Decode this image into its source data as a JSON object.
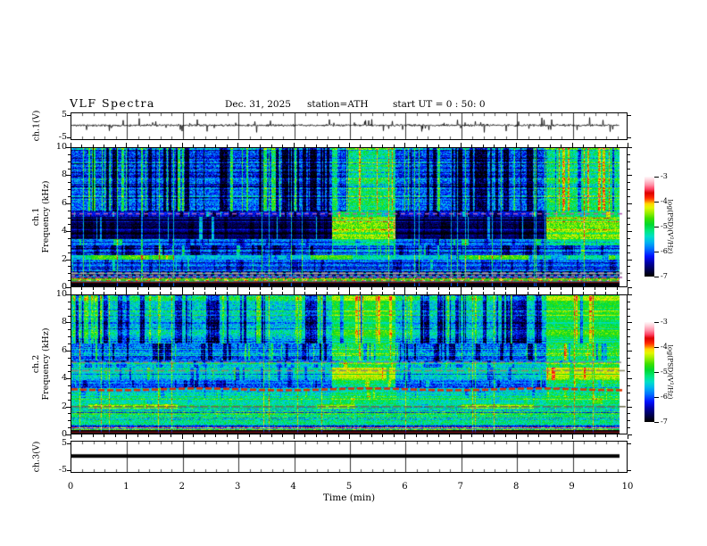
{
  "title": {
    "main": "VLF  Spectra",
    "date": "Dec. 31,  2025",
    "station": "station=ATH",
    "start_ut": "start  UT  =   0 : 50: 0"
  },
  "axes": {
    "x": {
      "label": "Time  (min)",
      "range_min": [
        0,
        10
      ],
      "ticks": [
        0,
        1,
        2,
        3,
        4,
        5,
        6,
        7,
        8,
        9,
        10
      ],
      "minor_step_min": 0.2
    },
    "spectrogram_y": {
      "unit": "kHz",
      "range": [
        0,
        10
      ],
      "ticks": [
        10,
        8,
        6,
        4,
        2,
        0
      ],
      "minor_step": 0.5
    },
    "waveform_y": {
      "unit": "V",
      "range": [
        -5,
        5
      ],
      "ticks": [
        5,
        -5
      ]
    }
  },
  "panels": [
    {
      "id": "ch1_wave",
      "ylabel": "ch.1(V)"
    },
    {
      "id": "ch1_spec",
      "ylabel_line1": "ch.1",
      "ylabel_line2": "Frequency  (kHz)"
    },
    {
      "id": "ch2_spec",
      "ylabel_line1": "ch.2",
      "ylabel_line2": "Frequency  (kHz)"
    },
    {
      "id": "ch3_wave",
      "ylabel": "ch.3(V)"
    }
  ],
  "colorbar": {
    "label": "log(PSD)(V²/Hz)",
    "ticks": [
      -3,
      -4,
      -5,
      -6,
      -7
    ],
    "range_log_psd": [
      -7,
      -3
    ]
  },
  "chart_data": [
    {
      "panel": "ch.1 waveform",
      "type": "line",
      "x_unit": "min",
      "y_unit": "V",
      "x_range": [
        0,
        9.84
      ],
      "y_range": [
        -5,
        5
      ],
      "baseline_v": 0.45,
      "noise_sd_v": 0.5,
      "spike_rate": 0.045,
      "spike_v_range": [
        1.2,
        3.6
      ],
      "seed": 11,
      "description": "continuous broadband noise trace near 0 V with frequent narrow spikes to about ±4 V"
    },
    {
      "panel": "ch.1 spectrogram",
      "type": "heatmap",
      "seed": 7,
      "t_end_min": 9.84,
      "f_range_khz": [
        0,
        10
      ],
      "psd_log_range": [
        -7,
        -3
      ],
      "bright_segments_min": [
        [
          4.68,
          5.82
        ],
        [
          8.52,
          9.84
        ]
      ],
      "sferic_prob": 0.035,
      "sferic_boost": 1.05,
      "row_var": 0.22,
      "regions": [
        {
          "f": [
            5.45,
            10
          ],
          "base": -6.05,
          "noise": 0.45,
          "dark_p": 0.32,
          "dark_d": -0.85,
          "bright_p": 0.13,
          "bright_d": 1.05,
          "seg_base": -5.15,
          "seg_dark_p": 0.1,
          "seg_bright_p": 0.16
        },
        {
          "f": [
            5.05,
            5.45
          ],
          "base": -6.25,
          "noise": 0.32,
          "dark_p": 0.2,
          "dark_d": -0.5,
          "bright_p": 0.05,
          "bright_d": 0.8,
          "seg_base": -5.0
        },
        {
          "f": [
            3.45,
            5.05
          ],
          "base": -6.75,
          "noise": 0.22,
          "dark_p": 0.28,
          "dark_d": -0.22,
          "bright_p": 0.04,
          "bright_d": 1.15,
          "seg_base": -4.6,
          "seg_noise": 0.4,
          "seg_dark_p": 0.03,
          "seg_bright_p": 0.05
        },
        {
          "f": [
            3.0,
            3.45
          ],
          "base": -5.9,
          "noise": 0.35,
          "dark_p": 0.15,
          "dark_d": -0.5,
          "bright_p": 0.06,
          "bright_d": 0.8,
          "seg_base": -5.2
        },
        {
          "f": [
            2.25,
            3.0
          ],
          "base": -6.15,
          "noise": 0.4,
          "dark_p": 0.25,
          "dark_d": -0.55,
          "bright_p": 0.07,
          "bright_d": 0.9,
          "seg_base": -5.9
        },
        {
          "f": [
            1.95,
            2.25
          ],
          "base": -5.55,
          "noise": 0.35,
          "dark_p": 0.1,
          "dark_d": -0.4,
          "bright_p": 0.05,
          "bright_d": 0.5,
          "seg_base": -5.3,
          "band_segments": [
            [
              0.25,
              1.85
            ],
            [
              4.3,
              5.05
            ],
            [
              6.95,
              8.2
            ]
          ],
          "band_base": -4.7,
          "band_noise": 0.3
        },
        {
          "f": [
            1.1,
            1.95
          ],
          "base": -5.95,
          "noise": 0.4,
          "dark_p": 0.2,
          "dark_d": -0.4,
          "bright_p": 0.05,
          "bright_d": 0.7
        },
        {
          "f": [
            0.55,
            1.1
          ],
          "base": -6.0,
          "noise": 0.5,
          "stripe_amp": 1.0
        },
        {
          "f": [
            0.28,
            0.55
          ],
          "base": -5.4,
          "noise": 0.6,
          "stripe_amp": 1.3
        },
        {
          "f": [
            0,
            0.28
          ],
          "base": -6.9,
          "noise": 0.12
        }
      ],
      "feature_lines": [
        {
          "f_khz": 5.25,
          "color": "#b05ab0",
          "dash": [
            5,
            4
          ],
          "w": 1.5
        },
        {
          "f_khz": 0.95,
          "color": "#a8a8a8",
          "dash": [
            7,
            3
          ],
          "w": 2
        },
        {
          "f_khz": 0.8,
          "color": "#8f8f8f",
          "dash": [
            4,
            4
          ],
          "w": 1.5
        },
        {
          "f_khz": 0.65,
          "color": "#a050a0",
          "dash": [
            5,
            4
          ],
          "w": 1.5
        },
        {
          "f_khz": 0.45,
          "color": "#22b822",
          "dash": [
            6,
            5
          ],
          "w": 1.5
        },
        {
          "f_khz": 0.3,
          "color": "#7a1212",
          "dash": [
            1,
            0
          ],
          "w": 1.5
        }
      ],
      "description": "blue background with dense dark-blue vertical sferic stripes above 5.5 kHz, near-black band 3.5-5 kHz, purple dashed line at 5.25 kHz, yellow-green band near 2.1 kHz in intervals, gray/purple/green line stack below 1 kHz, black at 0; green emission band 3.5-5 kHz during 4.7-5.8 and 8.5-9.8 min"
    },
    {
      "panel": "ch.2 spectrogram",
      "type": "heatmap",
      "seed": 13,
      "t_end_min": 9.84,
      "f_range_khz": [
        0,
        10
      ],
      "psd_log_range": [
        -7,
        -3
      ],
      "bright_segments_min": [
        [
          4.68,
          5.82
        ],
        [
          8.52,
          9.84
        ]
      ],
      "sferic_prob": 0.03,
      "sferic_boost": 0.9,
      "row_var": 0.22,
      "regions": [
        {
          "f": [
            6.5,
            10
          ],
          "base": -5.45,
          "noise": 0.45,
          "dark_p": 0.3,
          "dark_d": -1.0,
          "bright_p": 0.1,
          "bright_d": 0.65,
          "seg_base": -4.85,
          "seg_dark_p": 0.05,
          "seg_noise": 0.3
        },
        {
          "f": [
            5.3,
            6.5
          ],
          "base": -5.9,
          "noise": 0.45,
          "dark_p": 0.33,
          "dark_d": -0.8,
          "bright_p": 0.08,
          "bright_d": 0.8,
          "seg_base": -5.0
        },
        {
          "f": [
            4.75,
            5.3
          ],
          "base": -5.5,
          "noise": 0.4,
          "dark_p": 0.2,
          "dark_d": -0.5,
          "bright_p": 0.05,
          "bright_d": 0.5,
          "seg_base": -4.9
        },
        {
          "f": [
            3.9,
            4.75
          ],
          "base": -5.45,
          "noise": 0.4,
          "dark_p": 0.15,
          "dark_d": -0.6,
          "bright_p": 0.06,
          "bright_d": 0.6,
          "seg_base": -4.35,
          "seg_noise": 0.25,
          "seg_dark_p": 0.03
        },
        {
          "f": [
            3.35,
            3.9
          ],
          "base": -5.95,
          "noise": 0.4,
          "dark_p": 0.2,
          "dark_d": -0.5,
          "bright_p": 0.05,
          "bright_d": 0.6,
          "seg_base": -5.1
        },
        {
          "f": [
            2.6,
            3.35
          ],
          "base": -5.5,
          "noise": 0.4,
          "dark_p": 0.08,
          "dark_d": -0.4,
          "bright_p": 0.05,
          "bright_d": 0.5,
          "seg_base": -5.2
        },
        {
          "f": [
            2.15,
            2.6
          ],
          "base": -5.25,
          "noise": 0.35,
          "dark_p": 0.05,
          "dark_d": -0.3,
          "bright_p": 0.05,
          "bright_d": 0.4,
          "seg_base": -5.0
        },
        {
          "f": [
            1.8,
            2.15
          ],
          "base": -5.2,
          "noise": 0.35,
          "dark_p": 0.05,
          "dark_d": -0.3,
          "bright_p": 0.05,
          "bright_d": 0.4,
          "band_segments": [
            [
              0.3,
              1.9
            ],
            [
              4.4,
              5.1
            ],
            [
              7.0,
              8.3
            ]
          ],
          "band_base": -4.55,
          "band_noise": 0.25
        },
        {
          "f": [
            0.6,
            1.8
          ],
          "base": -5.25,
          "noise": 0.45,
          "stripe_amp": 0.6
        },
        {
          "f": [
            0.25,
            0.6
          ],
          "base": -5.6,
          "noise": 0.5,
          "stripe_amp": 1.3
        },
        {
          "f": [
            0,
            0.25
          ],
          "base": -6.85,
          "noise": 0.12
        }
      ],
      "feature_lines": [
        {
          "f_khz": 5.15,
          "color": "#8a8a8a",
          "dash": [
            6,
            4
          ],
          "w": 1.5
        },
        {
          "f_khz": 4.55,
          "color": "#8d8d6d",
          "dash": [
            8,
            4
          ],
          "w": 1.5
        },
        {
          "f_khz": 3.2,
          "color": "#dd3300",
          "dash": [
            7,
            3
          ],
          "w": 2.5,
          "wobble": 1
        },
        {
          "f_khz": 1.95,
          "color": "#6d6d4d",
          "dash": [
            9,
            3
          ],
          "w": 1.5
        },
        {
          "f_khz": 0.1,
          "color": "#7a1212",
          "dash": [
            1,
            0
          ],
          "w": 1.5
        }
      ],
      "description": "cyan/green background, dark-blue vertical stripes 5-10 kHz, bold red-orange dashed line at 3.2 kHz, gray dashed lines near 4.5-5.2 kHz, yellow band 1.8-2.1 kHz in intervals, green banding below 2 kHz, black at 0; bright green/yellow emission during 4.7-5.8 and 8.5-9.8 min"
    },
    {
      "panel": "ch.3 waveform",
      "type": "flatline",
      "x_unit": "min",
      "y_unit": "V",
      "x_range": [
        0,
        9.84
      ],
      "y_range": [
        -5,
        5
      ],
      "value_v": 0.3,
      "thickness_v": 1.4,
      "description": "constant thick black line just above 0 V for the full record"
    }
  ],
  "colormap_stops": [
    [
      0.0,
      "#000000"
    ],
    [
      0.06,
      "#00004a"
    ],
    [
      0.13,
      "#0000a0"
    ],
    [
      0.2,
      "#0010ff"
    ],
    [
      0.28,
      "#0077ff"
    ],
    [
      0.34,
      "#00b4f0"
    ],
    [
      0.4,
      "#00e0c8"
    ],
    [
      0.46,
      "#00e87a"
    ],
    [
      0.52,
      "#00d830"
    ],
    [
      0.58,
      "#3ae000"
    ],
    [
      0.64,
      "#9cee00"
    ],
    [
      0.69,
      "#e4f800"
    ],
    [
      0.73,
      "#ffd800"
    ],
    [
      0.76,
      "#ff7700"
    ],
    [
      0.79,
      "#ff2a00"
    ],
    [
      0.84,
      "#dd0000"
    ],
    [
      0.88,
      "#ff4466"
    ],
    [
      0.92,
      "#ff8fa6"
    ],
    [
      0.96,
      "#ffc6d2"
    ],
    [
      1.0,
      "#fff6f8"
    ]
  ]
}
